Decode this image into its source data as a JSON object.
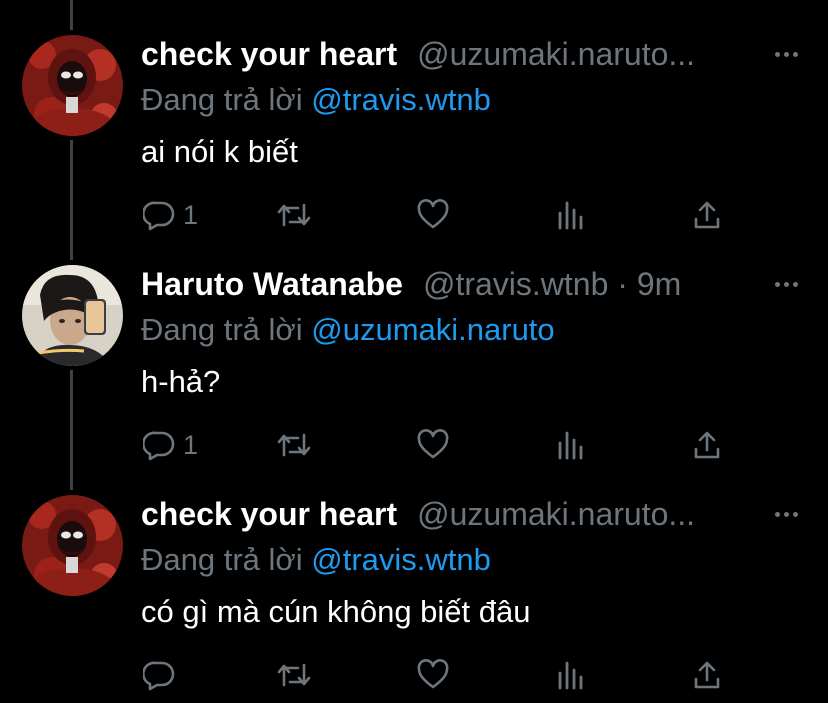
{
  "colors": {
    "background": "#000000",
    "name": "#ffffff",
    "secondary": "#6e767d",
    "link": "#1d9bf0",
    "thread_line": "#3d4247"
  },
  "tweets": [
    {
      "display_name": "check your heart",
      "handle": "@uzumaki.naruto...",
      "reply_prefix": "Đang trả lời",
      "reply_to": "@travis.wtnb",
      "text": "ai nói k biết",
      "reply_count": "1",
      "avatar": "red-hoodie-mask-avatar"
    },
    {
      "display_name": "Haruto Watanabe",
      "handle": "@travis.wtnb · 9m",
      "reply_prefix": "Đang trả lời",
      "reply_to": "@uzumaki.naruto",
      "text": "h-hả?",
      "reply_count": "1",
      "avatar": "mirror-selfie-avatar"
    },
    {
      "display_name": "check your heart",
      "handle": "@uzumaki.naruto...",
      "reply_prefix": "Đang trả lời",
      "reply_to": "@travis.wtnb",
      "text": "có gì mà cún không biết đâu",
      "reply_count": "",
      "avatar": "red-hoodie-mask-avatar"
    }
  ],
  "icons": {
    "reply": "reply-icon",
    "retweet": "retweet-icon",
    "like": "heart-icon",
    "analytics": "analytics-icon",
    "share": "share-icon",
    "more": "more-icon"
  }
}
